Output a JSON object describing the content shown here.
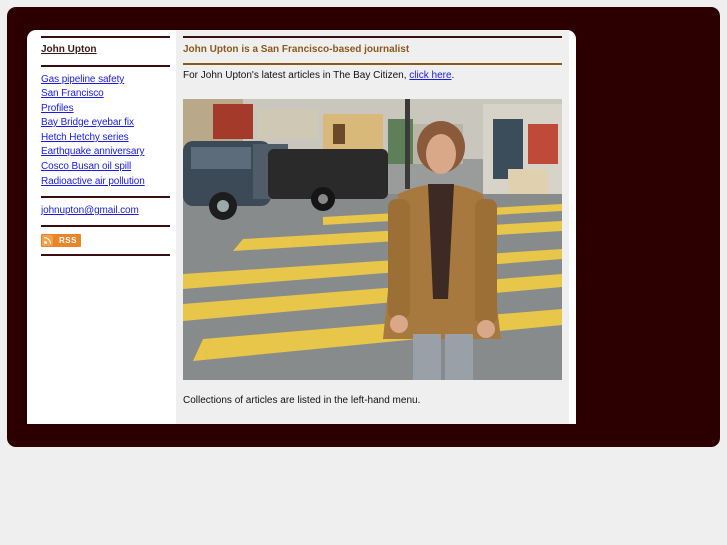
{
  "sidebar": {
    "title": "John Upton",
    "links": [
      "Gas pipeline safety",
      "San Francisco",
      "Profiles",
      "Bay Bridge eyebar fix",
      "Hetch Hetchy series",
      "Earthquake anniversary",
      "Cosco Busan oil spill",
      "Radioactive air pollution"
    ],
    "email": "johnupton@gmail.com",
    "rss_label": "RSS"
  },
  "main": {
    "title": "John Upton is a San Francisco-based journalist",
    "intro_prefix": "For John Upton's latest articles in The Bay Citizen, ",
    "intro_link": "click here",
    "intro_suffix": ".",
    "footer": "Collections of articles are listed in the left-hand menu."
  },
  "colors": {
    "frame": "#2d0000",
    "page_bg": "#efefef",
    "title_color": "#8a5a1a",
    "link_color": "#1a1aee"
  }
}
